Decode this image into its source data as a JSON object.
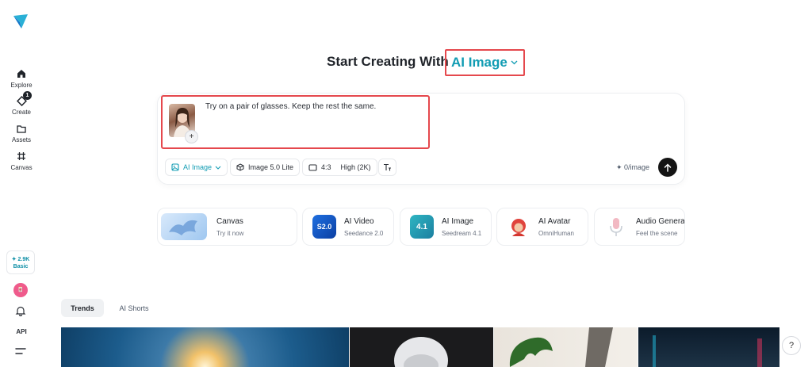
{
  "sidebar": {
    "items": [
      {
        "label": "Explore",
        "icon": "home-icon"
      },
      {
        "label": "Create",
        "icon": "create-icon",
        "badge": "1"
      },
      {
        "label": "Assets",
        "icon": "folder-icon"
      },
      {
        "label": "Canvas",
        "icon": "canvas-icon"
      }
    ],
    "credits": {
      "amount": "✦ 2.9K",
      "plan": "Basic"
    },
    "avatar_text": "🀄",
    "api_label": "API"
  },
  "heading": {
    "prefix": "Start Creating With",
    "mode": "AI Image"
  },
  "prompt": {
    "text": "Try on a pair of glasses. Keep the rest the same.",
    "add_symbol": "+"
  },
  "toolbar": {
    "mode": "AI Image",
    "model": "Image 5.0 Lite",
    "ratio": "4:3",
    "quality": "High (2K)",
    "counter": "✦ 0/image"
  },
  "features": [
    {
      "title": "Canvas",
      "subtitle": "Try it now"
    },
    {
      "title": "AI Video",
      "subtitle": "Seedance 2.0",
      "badge": "S2.0"
    },
    {
      "title": "AI Image",
      "subtitle": "Seedream 4.1",
      "badge": "4.1"
    },
    {
      "title": "AI Avatar",
      "subtitle": "OmniHuman"
    },
    {
      "title": "Audio Genera",
      "subtitle": "Feel the scene"
    }
  ],
  "tabs": [
    {
      "label": "Trends",
      "active": true
    },
    {
      "label": "AI Shorts",
      "active": false
    }
  ],
  "help_label": "?",
  "colors": {
    "accent": "#119cb3",
    "highlight_border": "#e5484d",
    "send_button": "#141414"
  }
}
